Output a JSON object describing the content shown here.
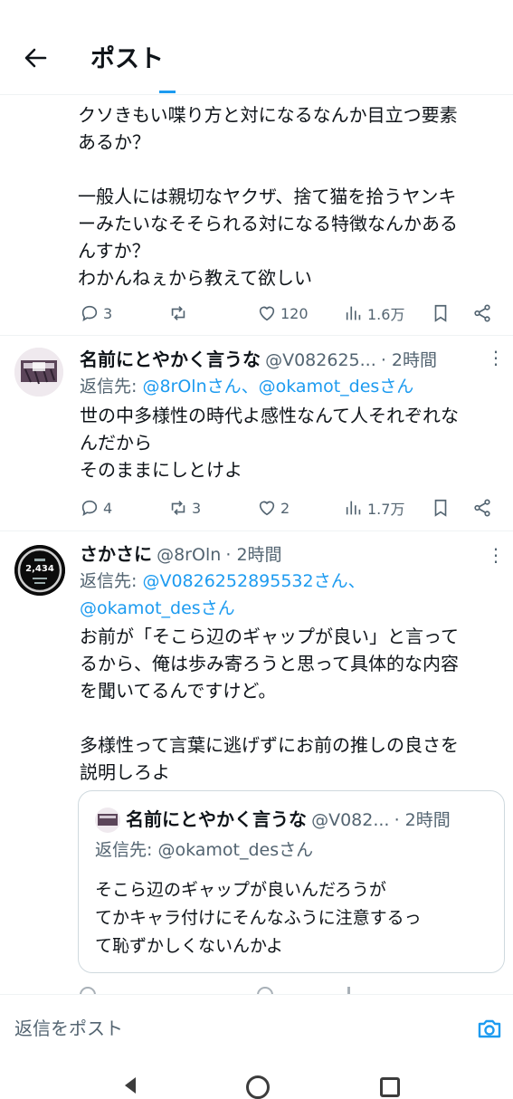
{
  "header": {
    "title": "ポスト"
  },
  "tweet1": {
    "text": "クソきもい喋り方と対になるなんか目立つ要素\nあるか？\n\n一般人には親切なヤクザ、捨て猫を拾うヤンキ\nーみたいなそそられる対になる特徴なんかある\nんすか？\nわかんねぇから教えて欲しい",
    "replies": "3",
    "likes": "120",
    "views": "1.6万"
  },
  "tweet2": {
    "name": "名前にとやかく言うな",
    "handle": "@V082625...",
    "time": "· 2時間",
    "reply_label": "返信先: ",
    "reply_to": "@8rOlnさん、@okamot_desさん",
    "text": "世の中多様性の時代よ感性なんて人それぞれな\nんだから\nそのままにしとけよ",
    "replies": "4",
    "retweets": "3",
    "likes": "2",
    "views": "1.7万"
  },
  "tweet3": {
    "name": "さかさに",
    "handle": "@8rOln",
    "time": "· 2時間",
    "reply_label": "返信先: ",
    "reply_to_line1": "@V0826252895532さん、",
    "reply_to_line2": "@okamot_desさん",
    "text": "お前が「そこら辺のギャップが良い」と言って\nるから、俺は歩み寄ろうと思って具体的な内容\nを聞いてるんですけど。\n\n多様性って言葉に逃げずにお前の推しの良さを\n説明しろよ",
    "avatar_number": "2,434"
  },
  "quote": {
    "name": "名前にとやかく言うな",
    "handle": "@V082...",
    "time": "· 2時間",
    "reply_to": "返信先: @okamot_desさん",
    "text": "そこら辺のギャップが良いんだろうが\nてかキャラ付けにそんなふうに注意するっ\nて恥ずかしくないんかよ"
  },
  "reply_bar": {
    "placeholder": "返信をポスト"
  }
}
